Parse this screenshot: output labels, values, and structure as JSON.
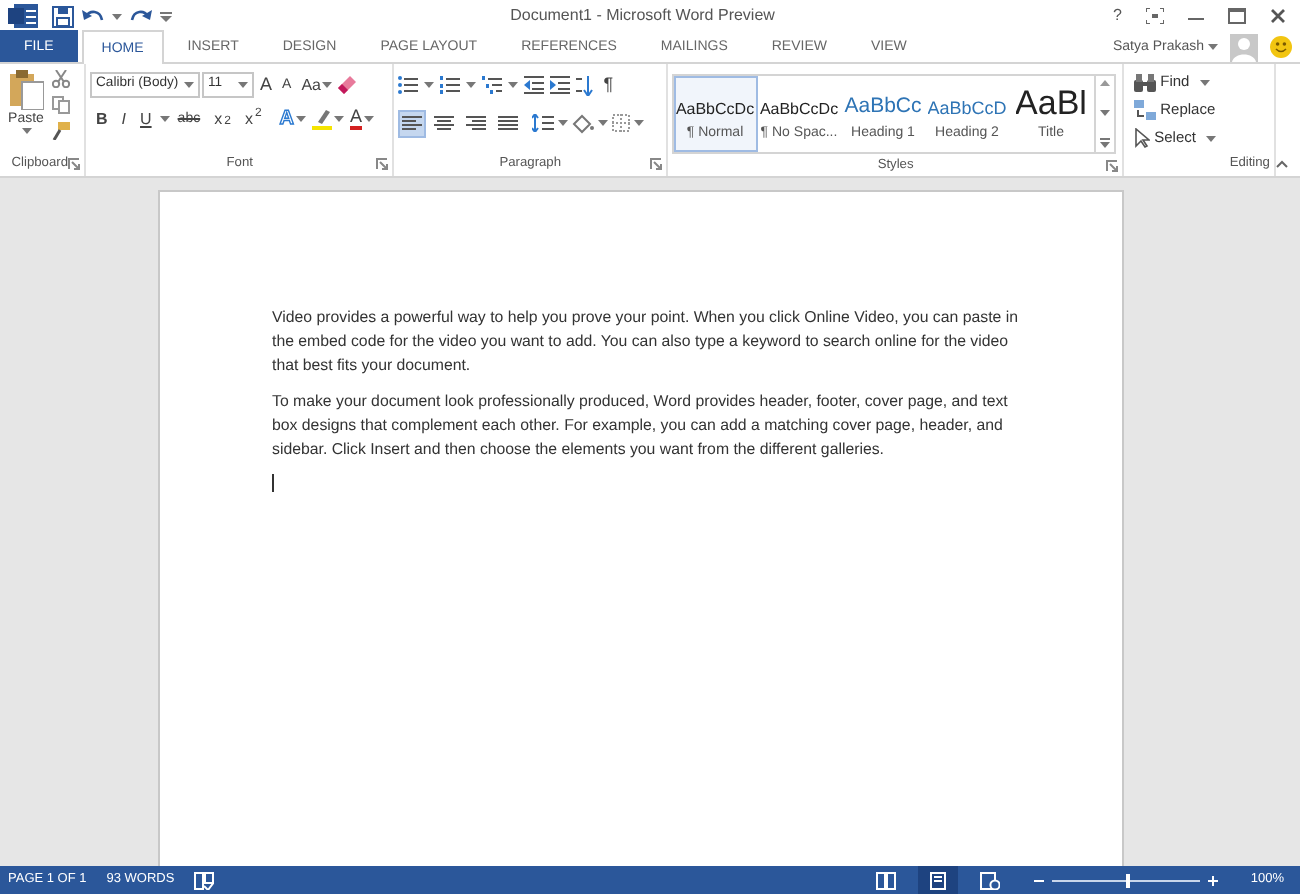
{
  "window": {
    "title": "Document1 - Microsoft Word Preview",
    "help": "?"
  },
  "account": {
    "user": "Satya Prakash"
  },
  "tabs": [
    {
      "label": "FILE",
      "kind": "file",
      "selected": false
    },
    {
      "label": "HOME",
      "kind": "tab",
      "selected": true
    },
    {
      "label": "INSERT",
      "kind": "tab",
      "selected": false
    },
    {
      "label": "DESIGN",
      "kind": "tab",
      "selected": false
    },
    {
      "label": "PAGE LAYOUT",
      "kind": "tab",
      "selected": false
    },
    {
      "label": "REFERENCES",
      "kind": "tab",
      "selected": false
    },
    {
      "label": "MAILINGS",
      "kind": "tab",
      "selected": false
    },
    {
      "label": "REVIEW",
      "kind": "tab",
      "selected": false
    },
    {
      "label": "VIEW",
      "kind": "tab",
      "selected": false
    }
  ],
  "ribbon": {
    "clipboard": {
      "label": "Clipboard",
      "paste": "Paste"
    },
    "font": {
      "label": "Font",
      "font_name": "Calibri (Body)",
      "font_size": "11",
      "size_buttons": [
        {
          "kind": "grow",
          "label": "A"
        },
        {
          "kind": "shrink",
          "label": "A"
        },
        {
          "kind": "case",
          "label": "Aa"
        }
      ],
      "format_buttons": [
        {
          "kind": "bold",
          "label": "B"
        },
        {
          "kind": "italic",
          "label": "I"
        },
        {
          "kind": "underline",
          "label": "U"
        },
        {
          "kind": "strike",
          "label": "abc"
        },
        {
          "kind": "subscript",
          "label": "x$_{2}$"
        },
        {
          "kind": "superscript",
          "label": "x$^{2}$"
        }
      ],
      "effects": "A",
      "font_color": "A"
    },
    "paragraph": {
      "label": "Paragraph",
      "pilcrow": "¶",
      "alignments": [
        {
          "kind": "left",
          "selected": true
        },
        {
          "kind": "center",
          "selected": false
        },
        {
          "kind": "right",
          "selected": false
        },
        {
          "kind": "justify",
          "selected": false
        }
      ]
    },
    "styles": {
      "label": "Styles",
      "items": [
        {
          "preview": "AaBbCcDc",
          "label": "¶ Normal",
          "kind": "normal",
          "selected": true
        },
        {
          "preview": "AaBbCcDc",
          "label": "¶ No Spac...",
          "kind": "normal",
          "selected": false
        },
        {
          "preview": "AaBbCc",
          "label": "Heading 1",
          "kind": "heading1",
          "selected": false
        },
        {
          "preview": "AaBbCcD",
          "label": "Heading 2",
          "kind": "heading2",
          "selected": false
        },
        {
          "preview": "AaBl",
          "label": "Title",
          "kind": "title",
          "selected": false
        }
      ]
    },
    "editing": {
      "label": "Editing",
      "items": [
        {
          "label": "Find",
          "kind": "find",
          "dropdown": true
        },
        {
          "label": "Replace",
          "kind": "replace",
          "dropdown": false
        },
        {
          "label": "Select",
          "kind": "select",
          "dropdown": true
        }
      ]
    }
  },
  "document": {
    "paragraphs": [
      "Video provides a powerful way to help you prove your point. When you click Online Video, you can paste in the embed code for the video you want to add. You can also type a keyword to search online for the video that best fits your document.",
      "To make your document look professionally produced, Word provides header, footer, cover page, and text box designs that complement each other. For example, you can add a matching cover page, header, and sidebar. Click Insert and then choose the elements you want from the different galleries."
    ]
  },
  "status_bar": {
    "page": "PAGE 1 OF 1",
    "words": "93 WORDS",
    "views": [
      {
        "kind": "read",
        "selected": false
      },
      {
        "kind": "print",
        "selected": true
      },
      {
        "kind": "web",
        "selected": false
      }
    ],
    "zoom": {
      "level": 0.5,
      "reading": "100%"
    }
  }
}
